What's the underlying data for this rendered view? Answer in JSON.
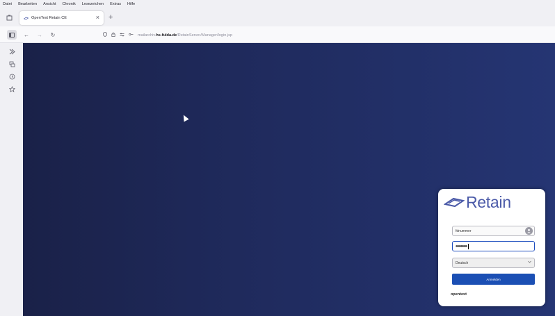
{
  "menu": [
    "Datei",
    "Bearbeiten",
    "Ansicht",
    "Chronik",
    "Lesezeichen",
    "Extras",
    "Hilfe"
  ],
  "tab": {
    "title": "OpenText Retain CE",
    "close": "×"
  },
  "new_tab": "+",
  "nav": {
    "back": "←",
    "forward": "→",
    "reload": "↻"
  },
  "url": {
    "prefix": "mailarchiv.",
    "host": "hs-fulda.de",
    "path": "/RetainServer/Manager/login.jsp"
  },
  "sidebar_icons": [
    "ai-chat-icon",
    "synced-tabs-icon",
    "history-icon",
    "bookmarks-icon"
  ],
  "login": {
    "logo": "Retain",
    "username": "fdnummer",
    "password": "•••••••••",
    "language": "Deutsch",
    "button": "Anmelden",
    "brand": "opentext"
  },
  "colors": {
    "brand_blue": "#4b5aa8",
    "button_blue": "#1b4fb4",
    "background_dark": "#1a2148",
    "background_light": "#253573"
  }
}
